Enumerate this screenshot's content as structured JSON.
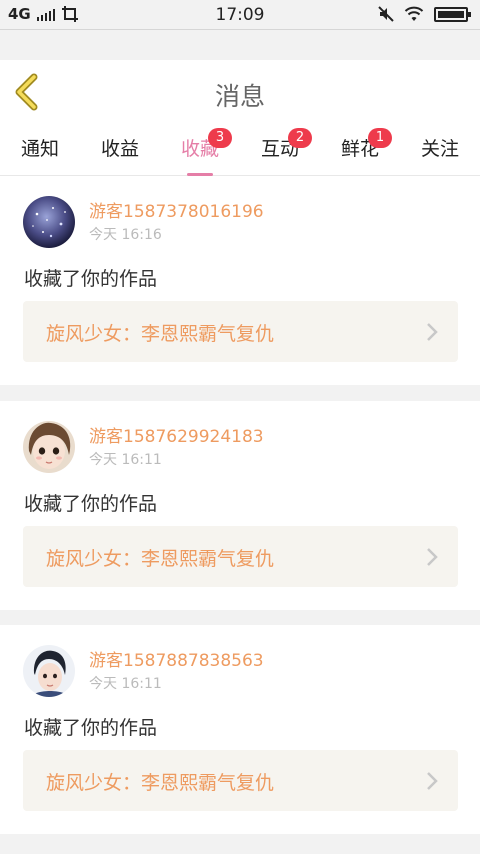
{
  "status_bar": {
    "network": "4G",
    "time": "17:09"
  },
  "header": {
    "title": "消息"
  },
  "tabs": [
    {
      "label": "通知",
      "badge": ""
    },
    {
      "label": "收益",
      "badge": ""
    },
    {
      "label": "收藏",
      "badge": "3"
    },
    {
      "label": "互动",
      "badge": "2"
    },
    {
      "label": "鲜花",
      "badge": "1"
    },
    {
      "label": "关注",
      "badge": ""
    }
  ],
  "active_tab": "收藏",
  "colors": {
    "accent": "#e57ea7",
    "name": "#ee9b60",
    "badge": "#ee3b4c"
  },
  "messages": [
    {
      "user": "游客1587378016196",
      "time": "今天 16:16",
      "action": "收藏了你的作品",
      "work": "旋风少女：李恩熙霸气复仇"
    },
    {
      "user": "游客1587629924183",
      "time": "今天 16:11",
      "action": "收藏了你的作品",
      "work": "旋风少女：李恩熙霸气复仇"
    },
    {
      "user": "游客1587887838563",
      "time": "今天 16:11",
      "action": "收藏了你的作品",
      "work": "旋风少女：李恩熙霸气复仇"
    }
  ]
}
